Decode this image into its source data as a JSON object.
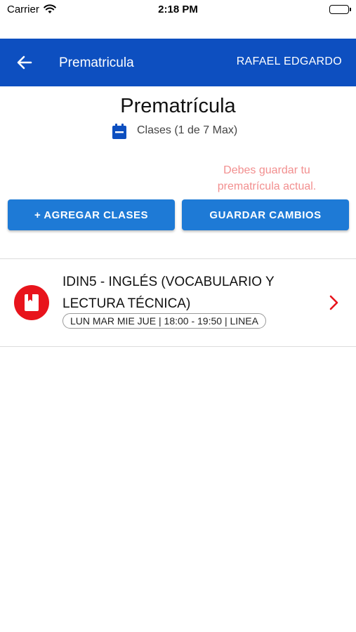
{
  "status_bar": {
    "carrier": "Carrier",
    "time": "2:18 PM"
  },
  "app_bar": {
    "title": "Prematricula",
    "user_name": "RAFAEL EDGARDO",
    "color": "#0d4fc0"
  },
  "page": {
    "title": "Prematrícula",
    "class_count_label": "Clases (1 de 7 Max)",
    "warning": "Debes guardar tu prematrícula actual."
  },
  "actions": {
    "add_label": "+ AGREGAR CLASES",
    "save_label": "GUARDAR CAMBIOS",
    "color": "#1e7ad6"
  },
  "courses": [
    {
      "title": "IDIN5 - INGLÉS (VOCABULARIO Y LECTURA TÉCNICA)",
      "schedule": "LUN MAR MIE JUE | 18:00 - 19:50 | LINEA",
      "icon": "book-icon",
      "badge_color": "#e8141c"
    }
  ]
}
